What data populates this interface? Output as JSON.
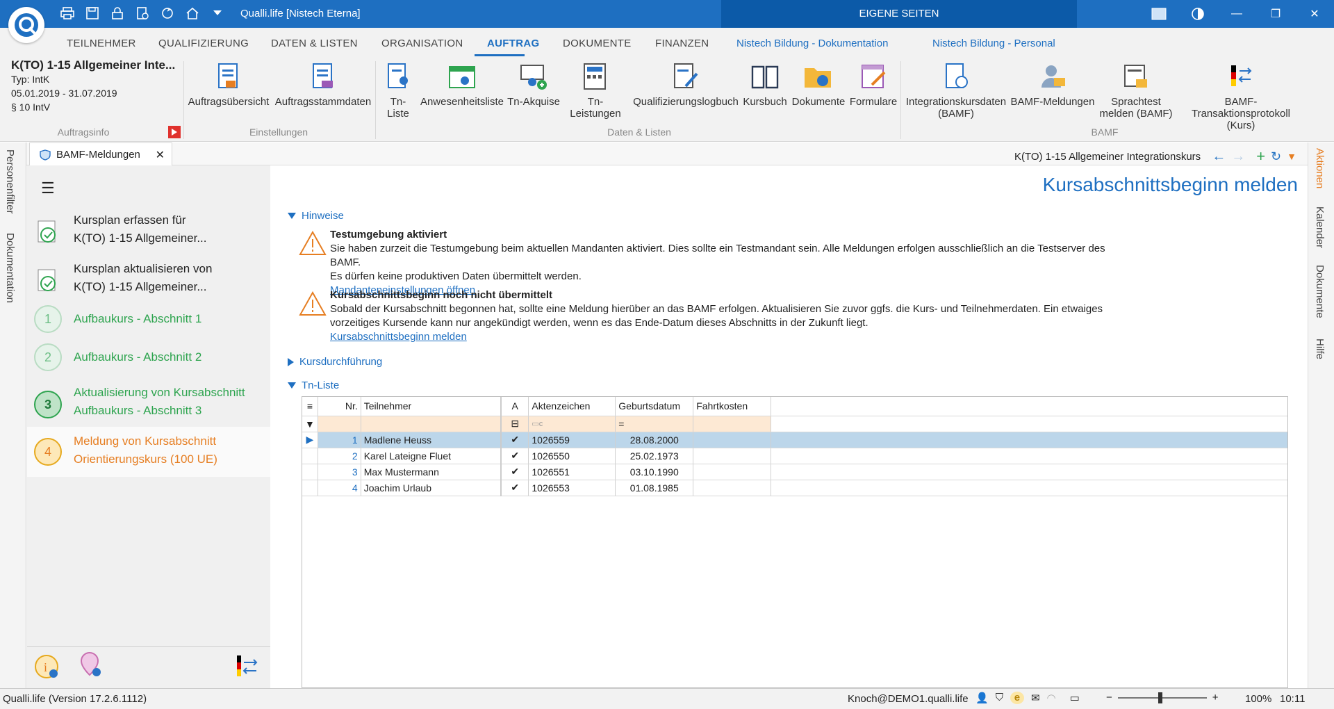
{
  "app": {
    "title": "Qualli.life [Nistech Eterna]",
    "eigene_seiten": "EIGENE SEITEN"
  },
  "menu": {
    "tabs": [
      "TEILNEHMER",
      "QUALIFIZIERUNG",
      "DATEN & LISTEN",
      "ORGANISATION",
      "AUFTRAG",
      "DOKUMENTE",
      "FINANZEN",
      "Nistech Bildung - Dokumentation",
      "Nistech Bildung - Personal"
    ],
    "active": "AUFTRAG"
  },
  "auftragsinfo": {
    "name": "K(TO) 1-15 Allgemeiner Inte...",
    "typ": "Typ: IntK",
    "zeitraum": "05.01.2019 - 31.07.2019",
    "paragraph": "§ 10 IntV",
    "group_label": "Auftragsinfo"
  },
  "ribbon": {
    "einstellungen": {
      "label": "Einstellungen",
      "buttons": [
        "Auftragsübersicht",
        "Auftragsstammdaten"
      ]
    },
    "daten_listen": {
      "label": "Daten & Listen",
      "buttons": [
        "Tn-Liste",
        "Anwesenheitsliste",
        "Tn-Akquise",
        "Tn-Leistungen",
        "Qualifizierungslogbuch",
        "Kursbuch",
        "Dokumente",
        "Formulare"
      ]
    },
    "bamf": {
      "label": "BAMF",
      "buttons": [
        {
          "l1": "Integrationskursdaten",
          "l2": "(BAMF)"
        },
        {
          "l1": "BAMF-Meldungen",
          "l2": ""
        },
        {
          "l1": "Sprachtest",
          "l2": "melden (BAMF)"
        },
        {
          "l1": "BAMF-Transaktionsprotokoll",
          "l2": "(Kurs)"
        }
      ]
    }
  },
  "doctab": {
    "label": "BAMF-Meldungen",
    "course": "K(TO) 1-15 Allgemeiner Integrationskurs"
  },
  "lefttabs": [
    "Personenfilter",
    "Dokumentation"
  ],
  "righttabs": [
    "Aktionen",
    "Kalender",
    "Dokumente",
    "Hilfe"
  ],
  "sidebar": {
    "steps": [
      {
        "l1": "Kursplan erfassen für",
        "l2": "K(TO) 1-15 Allgemeiner...",
        "state": "done"
      },
      {
        "l1": "Kursplan aktualisieren von",
        "l2": "K(TO) 1-15 Allgemeiner...",
        "state": "done"
      },
      {
        "num": "1",
        "l1": "Aufbaukurs - Abschnitt 1",
        "l2": "",
        "state": "light"
      },
      {
        "num": "2",
        "l1": "Aufbaukurs - Abschnitt 2",
        "l2": "",
        "state": "light"
      },
      {
        "num": "3",
        "l1": "Aktualisierung von Kursabschnitt",
        "l2": "Aufbaukurs - Abschnitt 3",
        "state": "green"
      },
      {
        "num": "4",
        "l1": "Meldung von Kursabschnitt",
        "l2": "Orientierungskurs (100 UE)",
        "state": "current"
      }
    ]
  },
  "main": {
    "heading": "Kursabschnittsbeginn melden",
    "hinweise": "Hinweise",
    "notices": [
      {
        "title": "Testumgebung aktiviert",
        "text1": "Sie haben zurzeit die Testumgebung beim aktuellen Mandanten aktiviert. Dies sollte ein Testmandant sein. Alle Meldungen erfolgen ausschließlich an die Testserver des BAMF.",
        "text2": "Es dürfen keine produktiven Daten übermittelt werden.",
        "link": "Mandanteneinstellungen öffnen"
      },
      {
        "title": "Kursabschnittsbeginn noch nicht übermittelt",
        "text1": "Sobald der Kursabschnitt begonnen hat, sollte eine Meldung hierüber an das BAMF erfolgen. Aktualisieren Sie zuvor ggfs. die Kurs- und Teilnehmerdaten. Ein etwaiges",
        "text2": "vorzeitiges Kursende kann nur angekündigt werden, wenn es das Ende-Datum dieses Abschnitts in der Zukunft liegt.",
        "link": "Kursabschnittsbeginn melden"
      }
    ],
    "kursdurchfuehrung": "Kursdurchführung",
    "tnliste": "Tn-Liste",
    "table": {
      "headers": [
        "Nr.",
        "Teilnehmer",
        "A",
        "Aktenzeichen",
        "Geburtsdatum",
        "Fahrtkosten"
      ],
      "rows": [
        {
          "nr": "1",
          "name": "Madlene Heuss",
          "a": "✔",
          "az": "1026559",
          "geb": "28.08.2000",
          "fk": ""
        },
        {
          "nr": "2",
          "name": "Karel Lateigne Fluet",
          "a": "✔",
          "az": "1026550",
          "geb": "25.02.1973",
          "fk": ""
        },
        {
          "nr": "3",
          "name": "Max Mustermann",
          "a": "✔",
          "az": "1026551",
          "geb": "03.10.1990",
          "fk": ""
        },
        {
          "nr": "4",
          "name": "Joachim Urlaub",
          "a": "✔",
          "az": "1026553",
          "geb": "01.08.1985",
          "fk": ""
        }
      ]
    }
  },
  "status": {
    "version": "Qualli.life (Version 17.2.6.1112)",
    "user": "Knoch@DEMO1.qualli.life",
    "zoom": "100%",
    "time": "10:11"
  },
  "colors": {
    "accent": "#1e6fc1",
    "green": "#2ea44f",
    "orange": "#e67e22"
  }
}
